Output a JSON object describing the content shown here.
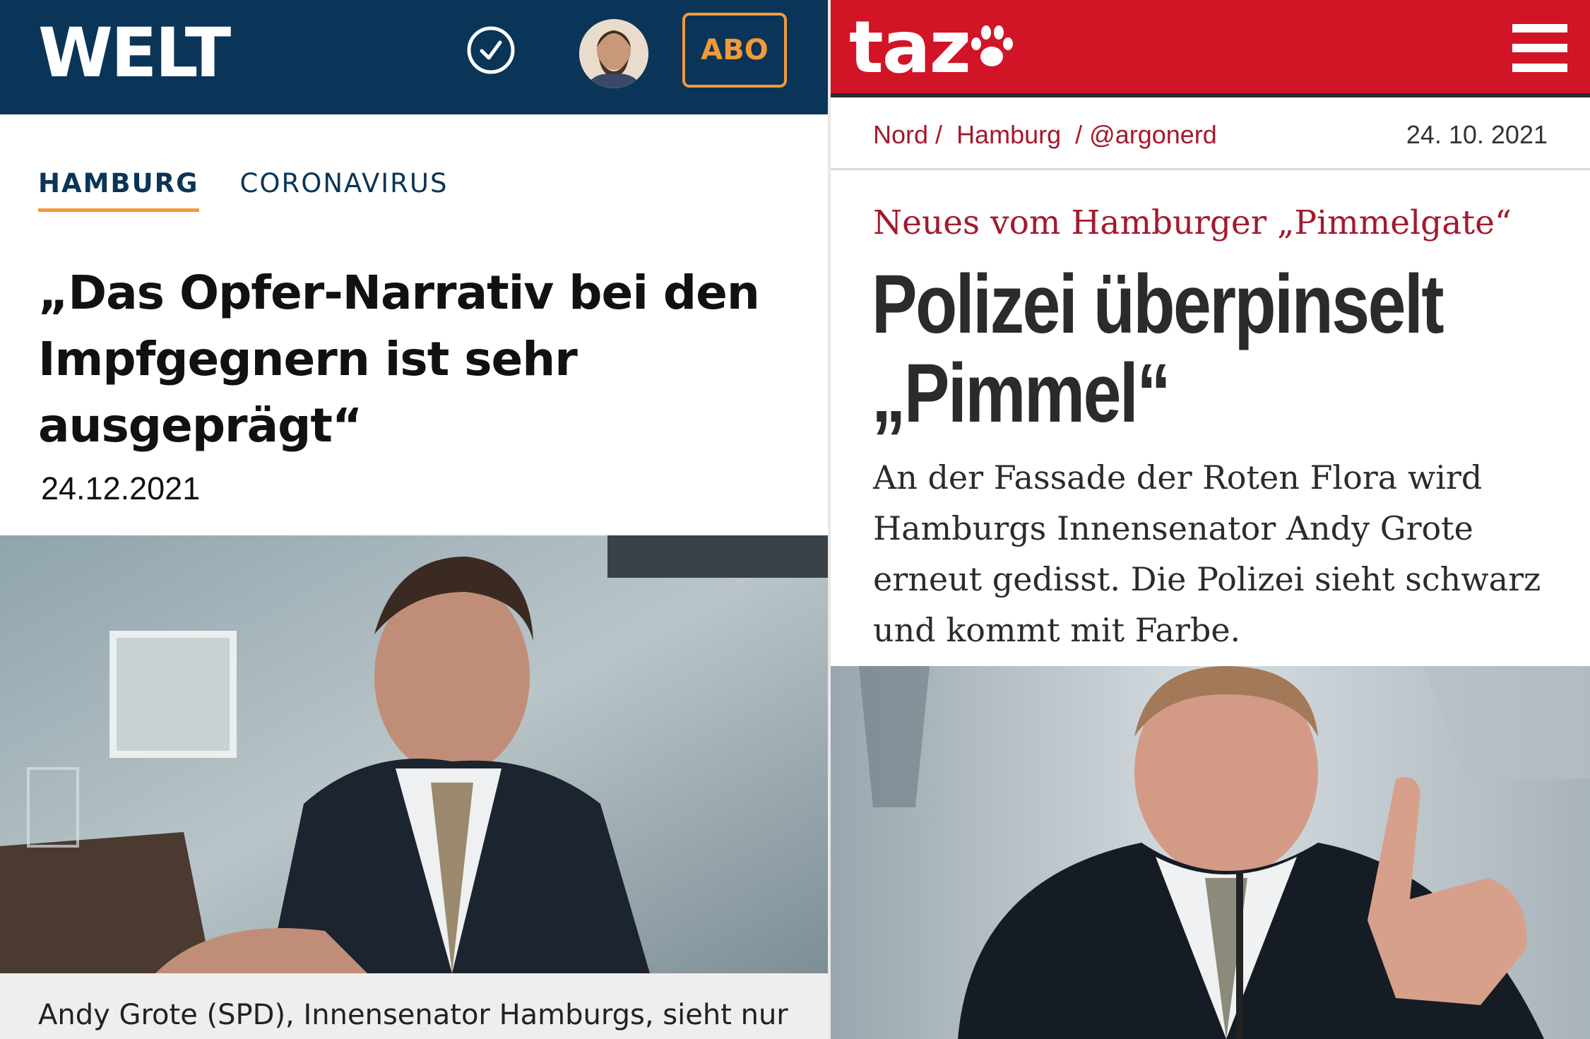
{
  "welt": {
    "logo": "WELT",
    "abo_label": "ABO",
    "tabs": [
      "HAMBURG",
      "CORONAVIRUS"
    ],
    "headline": "„Das Opfer-Narrativ bei den Impfgegnern ist sehr ausgeprägt“",
    "date": "24.12.2021",
    "caption": "Andy Grote (SPD), Innensenator Hamburgs, sieht nur",
    "icons": [
      "clock-check-icon",
      "user-avatar"
    ],
    "colors": {
      "header": "#0a3558",
      "accent": "#f29a3a"
    }
  },
  "taz": {
    "logo": "taz",
    "breadcrumb": [
      "Nord /",
      "Hamburg",
      "/ @argonerd"
    ],
    "date": "24. 10. 2021",
    "kicker": "Neues vom Hamburger „Pimmelgate“",
    "headline": "Polizei überpinselt „Pimmel“",
    "teaser": "An der Fassade der Roten Flora wird Hamburgs Innensenator Andy Grote erneut gedisst. Die Polizei sieht schwarz und kommt mit Farbe.",
    "icons": [
      "paw-icon",
      "hamburger-menu-icon"
    ],
    "colors": {
      "header": "#d21427",
      "accent": "#a4192c"
    }
  }
}
